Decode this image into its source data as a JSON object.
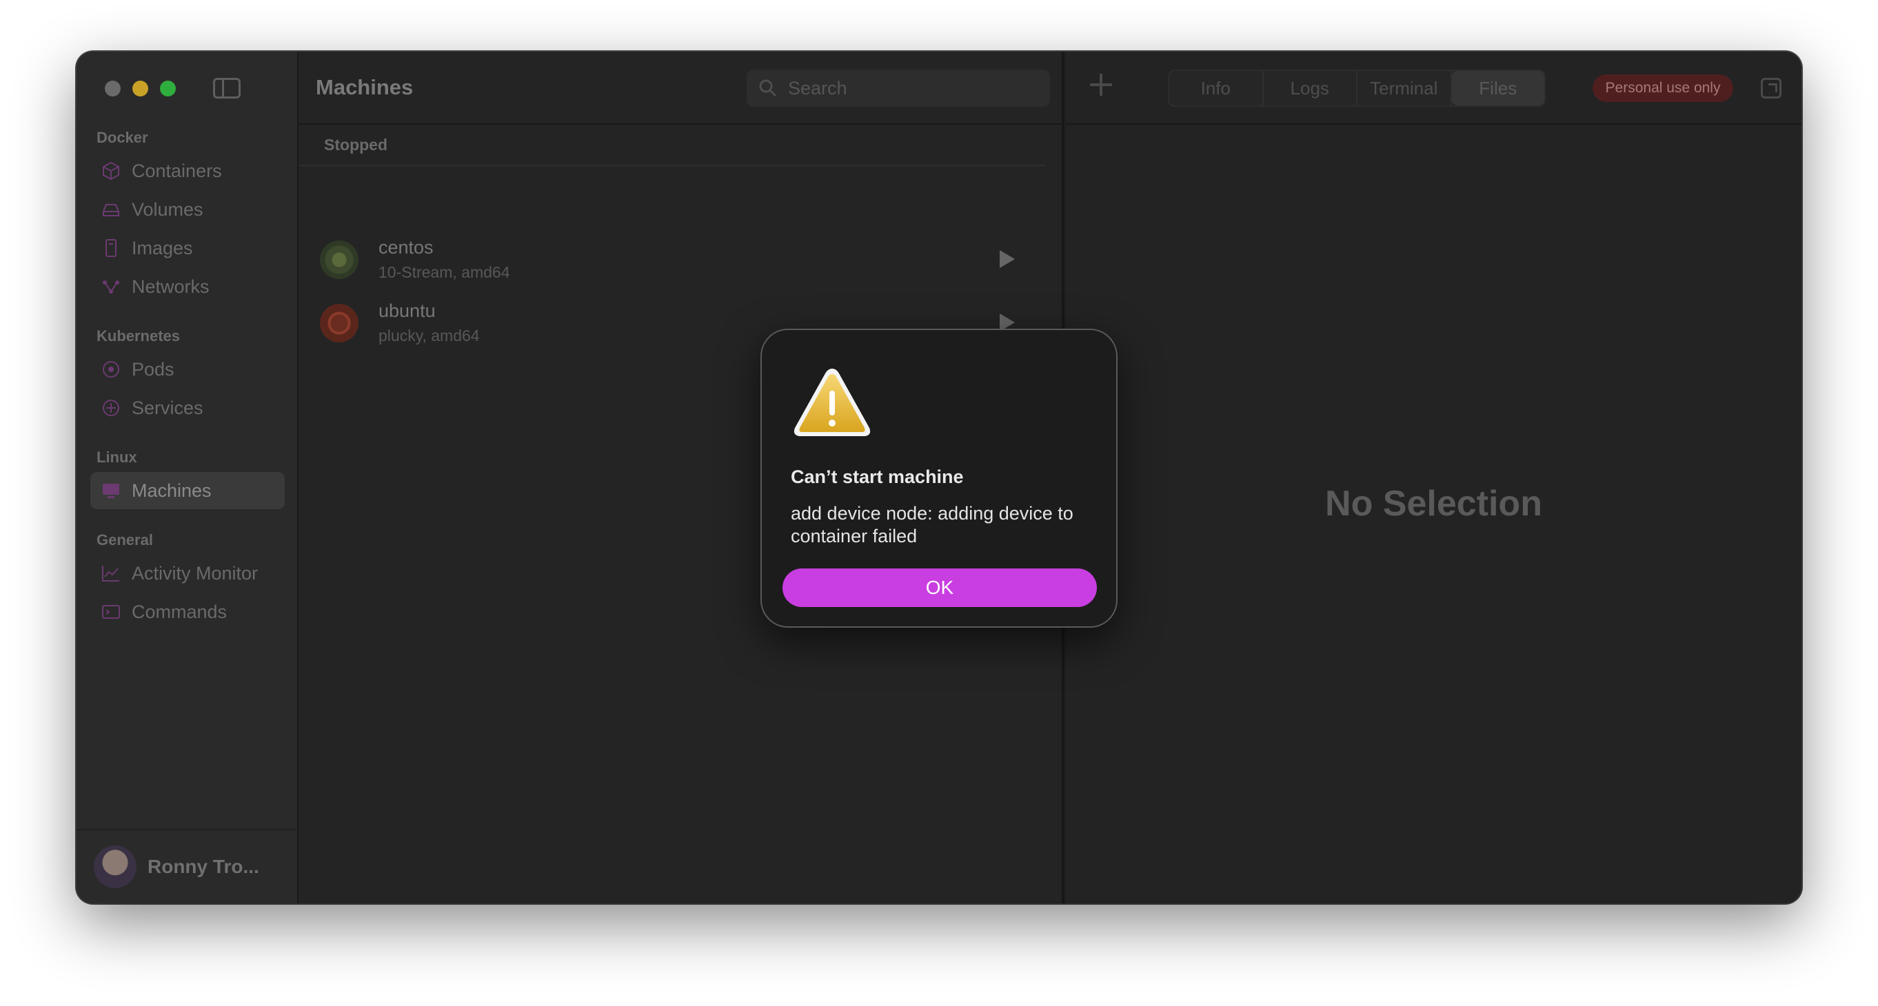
{
  "sidebar": {
    "sections": [
      {
        "title": "Docker",
        "items": [
          {
            "label": "Containers",
            "icon": "cube-icon"
          },
          {
            "label": "Volumes",
            "icon": "drive-icon"
          },
          {
            "label": "Images",
            "icon": "image-icon"
          },
          {
            "label": "Networks",
            "icon": "network-icon"
          }
        ]
      },
      {
        "title": "Kubernetes",
        "items": [
          {
            "label": "Pods",
            "icon": "pod-icon"
          },
          {
            "label": "Services",
            "icon": "service-icon"
          }
        ]
      },
      {
        "title": "Linux",
        "items": [
          {
            "label": "Machines",
            "icon": "monitor-icon"
          }
        ]
      },
      {
        "title": "General",
        "items": [
          {
            "label": "Activity Monitor",
            "icon": "chart-icon"
          },
          {
            "label": "Commands",
            "icon": "terminal-icon"
          }
        ]
      }
    ],
    "user": {
      "name": "Ronny Tro..."
    }
  },
  "middle": {
    "title": "Machines",
    "search_placeholder": "Search",
    "group_header": "Stopped",
    "machines": [
      {
        "name": "centos",
        "details": "10-Stream, amd64"
      },
      {
        "name": "ubuntu",
        "details": "plucky, amd64"
      }
    ]
  },
  "right": {
    "tabs": [
      "Info",
      "Logs",
      "Terminal",
      "Files"
    ],
    "badge": "Personal use only",
    "empty_text": "No Selection"
  },
  "dialog": {
    "title": "Can’t start machine",
    "message": "add device node: adding device to container failed",
    "ok_label": "OK"
  },
  "colors": {
    "accent": "#c93ee0",
    "badge_bg": "#4f1f1f"
  }
}
